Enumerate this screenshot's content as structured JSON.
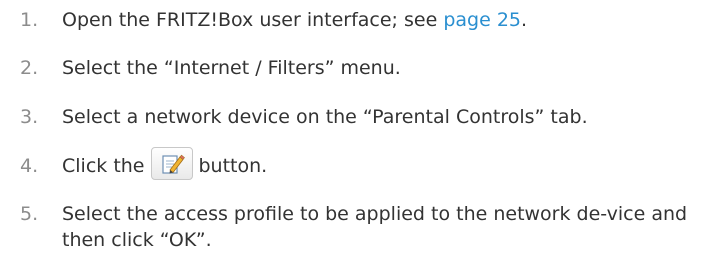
{
  "steps": [
    {
      "number": "1.",
      "text_before": "Open the FRITZ!Box user interface; see ",
      "link": "page 25",
      "text_after": "."
    },
    {
      "number": "2.",
      "text": "Select the “Internet / Filters” menu."
    },
    {
      "number": "3.",
      "text": "Select a network device on the “Parental Controls” tab."
    },
    {
      "number": "4.",
      "text_before": "Click the",
      "button_icon": "edit-icon",
      "text_after": "button."
    },
    {
      "number": "5.",
      "text": "Select the access profile to be applied to the network de-vice and then click “OK”."
    }
  ],
  "colors": {
    "text": "#333333",
    "number": "#8c8c8c",
    "link": "#2a8fd0"
  }
}
